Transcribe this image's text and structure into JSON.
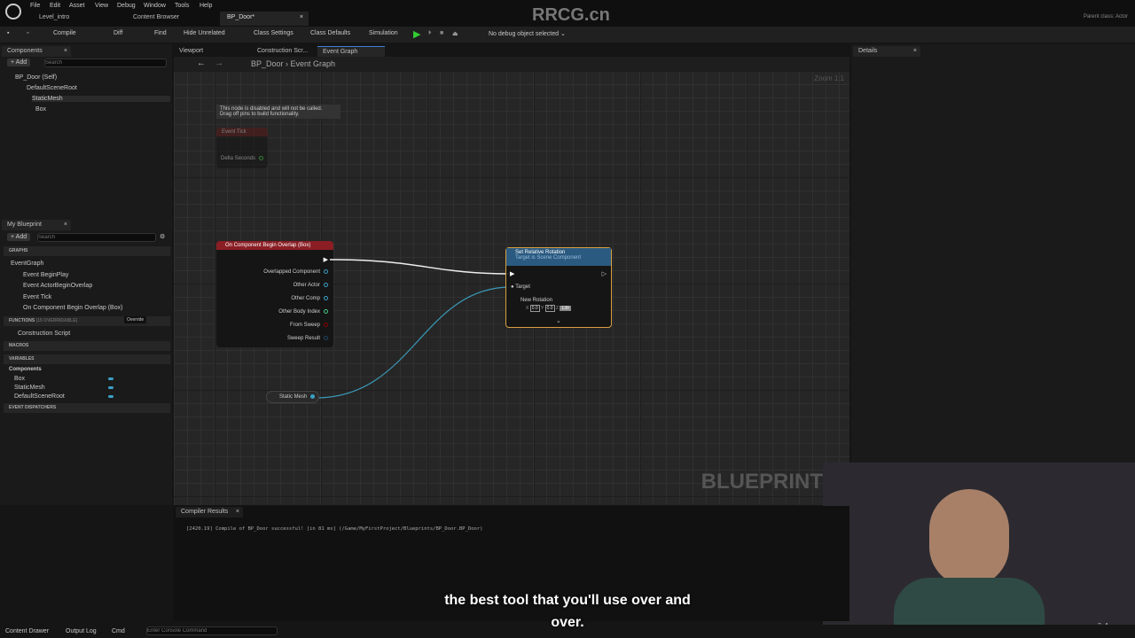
{
  "menu": [
    "File",
    "Edit",
    "Asset",
    "View",
    "Debug",
    "Window",
    "Tools",
    "Help"
  ],
  "doc_tabs": [
    "Level_intro",
    "Content Browser",
    "BP_Door*"
  ],
  "parent_class": {
    "label": "Parent class:",
    "value": "Actor"
  },
  "toolbar": {
    "compile": "Compile",
    "diff": "Diff",
    "find": "Find",
    "hide_unrelated": "Hide Unrelated",
    "class_settings": "Class Settings",
    "class_defaults": "Class Defaults",
    "simulation": "Simulation",
    "debug_object": "No debug object selected"
  },
  "components": {
    "title": "Components",
    "add": "+ Add",
    "search_placeholder": "Search",
    "tree": [
      "BP_Door (Self)",
      "DefaultSceneRoot",
      "StaticMesh",
      "Box"
    ]
  },
  "my_blueprint": {
    "title": "My Blueprint",
    "add": "+ Add",
    "search_placeholder": "Search",
    "graphs_label": "GRAPHS",
    "event_graph": "EventGraph",
    "events": [
      "Event BeginPlay",
      "Event ActorBeginOverlap",
      "Event Tick",
      "On Component Begin Overlap (Box)"
    ],
    "functions_label": "FUNCTIONS",
    "functions_count": "(15 OVERRIDABLE)",
    "override": "Override",
    "construction_script": "Construction Script",
    "macros_label": "MACROS",
    "variables_label": "VARIABLES",
    "components_label": "Components",
    "variables": [
      "Box",
      "StaticMesh",
      "DefaultSceneRoot"
    ],
    "dispatchers_label": "EVENT DISPATCHERS"
  },
  "editor_tabs": [
    "Viewport",
    "Construction Scr...",
    "Event Graph"
  ],
  "breadcrumb": {
    "root": "BP_Door",
    "current": "Event Graph"
  },
  "zoom": "Zoom 1:1",
  "graph": {
    "disabled_note": [
      "This node is disabled and will not be called.",
      "Drag off pins to build functionality."
    ],
    "event_tick": {
      "title": "Event Tick",
      "pin": "Delta Seconds"
    },
    "overlap": {
      "title": "On Component Begin Overlap (Box)",
      "pins": [
        "Overlapped Component",
        "Other Actor",
        "Other Comp",
        "Other Body Index",
        "From Sweep",
        "Sweep Result"
      ]
    },
    "set_rotation": {
      "title": "Set Relative Rotation",
      "subtitle": "Target is Scene Component",
      "target": "Target",
      "new_rotation": "New Rotation",
      "x": "0.0",
      "y": "0.0",
      "z": "130"
    },
    "static_mesh": "Static Mesh",
    "watermark": "BLUEPRINT"
  },
  "details": {
    "title": "Details"
  },
  "compiler": {
    "title": "Compiler Results",
    "message": "[2420.19] Compile of BP_Door successful! [in 81 ms] (/Game/MyFirstProject/Blueprints/BP_Door.BP_Door)"
  },
  "statusbar": {
    "content_drawer": "Content Drawer",
    "output_log": "Output Log",
    "cmd": "Cmd",
    "console_placeholder": "Enter Console Command"
  },
  "subtitles": {
    "line1": "the best tool that you'll use over and",
    "line2": "over."
  },
  "watermarks": {
    "site": "RRCG.cn",
    "udemy": "ūdemy"
  }
}
